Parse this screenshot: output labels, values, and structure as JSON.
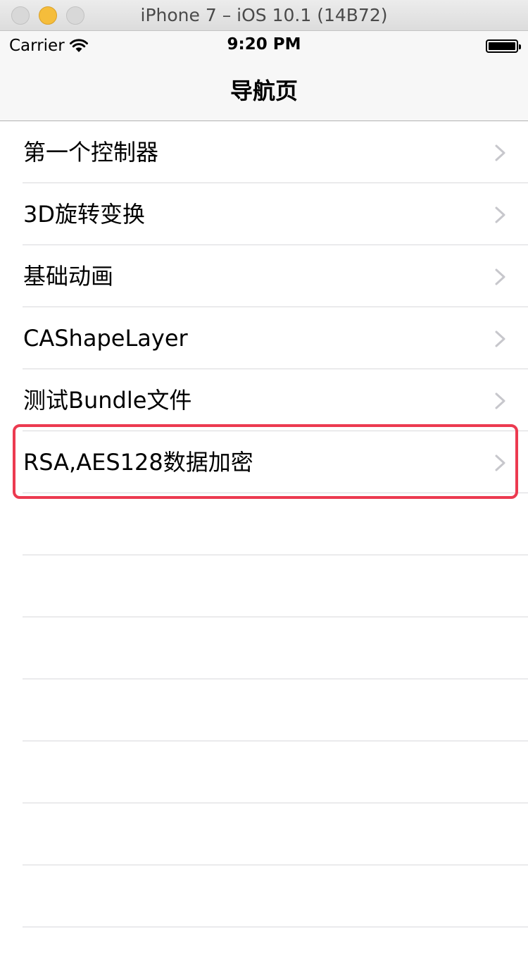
{
  "window": {
    "title": "iPhone 7 – iOS 10.1 (14B72)"
  },
  "status_bar": {
    "carrier": "Carrier",
    "time": "9:20 PM"
  },
  "nav": {
    "title": "导航页"
  },
  "table": {
    "rows": [
      "第一个控制器",
      "3D旋转变换",
      "基础动画",
      "CAShapeLayer",
      "测试Bundle文件",
      "RSA,AES128数据加密"
    ]
  },
  "colors": {
    "highlight": "#ec3a50",
    "chevron": "#c7c7cc",
    "separator": "#d9d9dc"
  }
}
